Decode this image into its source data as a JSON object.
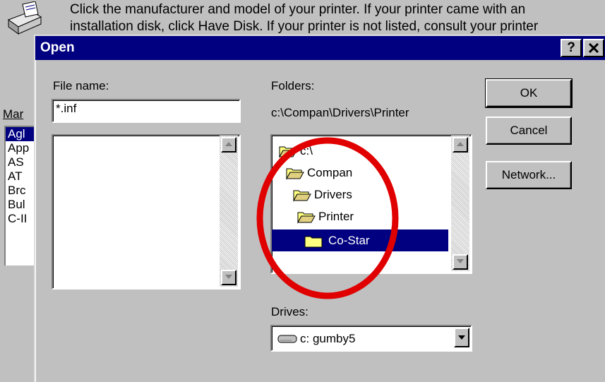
{
  "background_wizard": {
    "instruction_line1": "Click the manufacturer and model of your printer. If your printer came with an",
    "instruction_line2": "installation disk, click Have Disk. If your printer is not listed, consult your printer",
    "manufacturers_label": "Mar",
    "manufacturers": [
      "Agl",
      "App",
      "AS",
      "AT",
      "Brc",
      "Bul",
      "C-II"
    ]
  },
  "dialog": {
    "title": "Open",
    "help_button": "?",
    "close_button": "✕",
    "file_name_label": "File name:",
    "file_name_value": "*.inf",
    "folders_label": "Folders:",
    "current_path": "c:\\Compan\\Drivers\\Printer",
    "folders": [
      {
        "label": "c:\\",
        "state": "open"
      },
      {
        "label": "Compan",
        "state": "open"
      },
      {
        "label": "Drivers",
        "state": "open"
      },
      {
        "label": "Printer",
        "state": "open"
      },
      {
        "label": "Co-Star",
        "state": "closed",
        "selected": true
      }
    ],
    "drives_label": "Drives:",
    "drive_value": "c: gumby5",
    "buttons": {
      "ok": "OK",
      "cancel": "Cancel",
      "network": "Network..."
    }
  },
  "colors": {
    "titlebar": "#000080",
    "face": "#c0c0c0",
    "annotation_circle": "#e00000"
  }
}
